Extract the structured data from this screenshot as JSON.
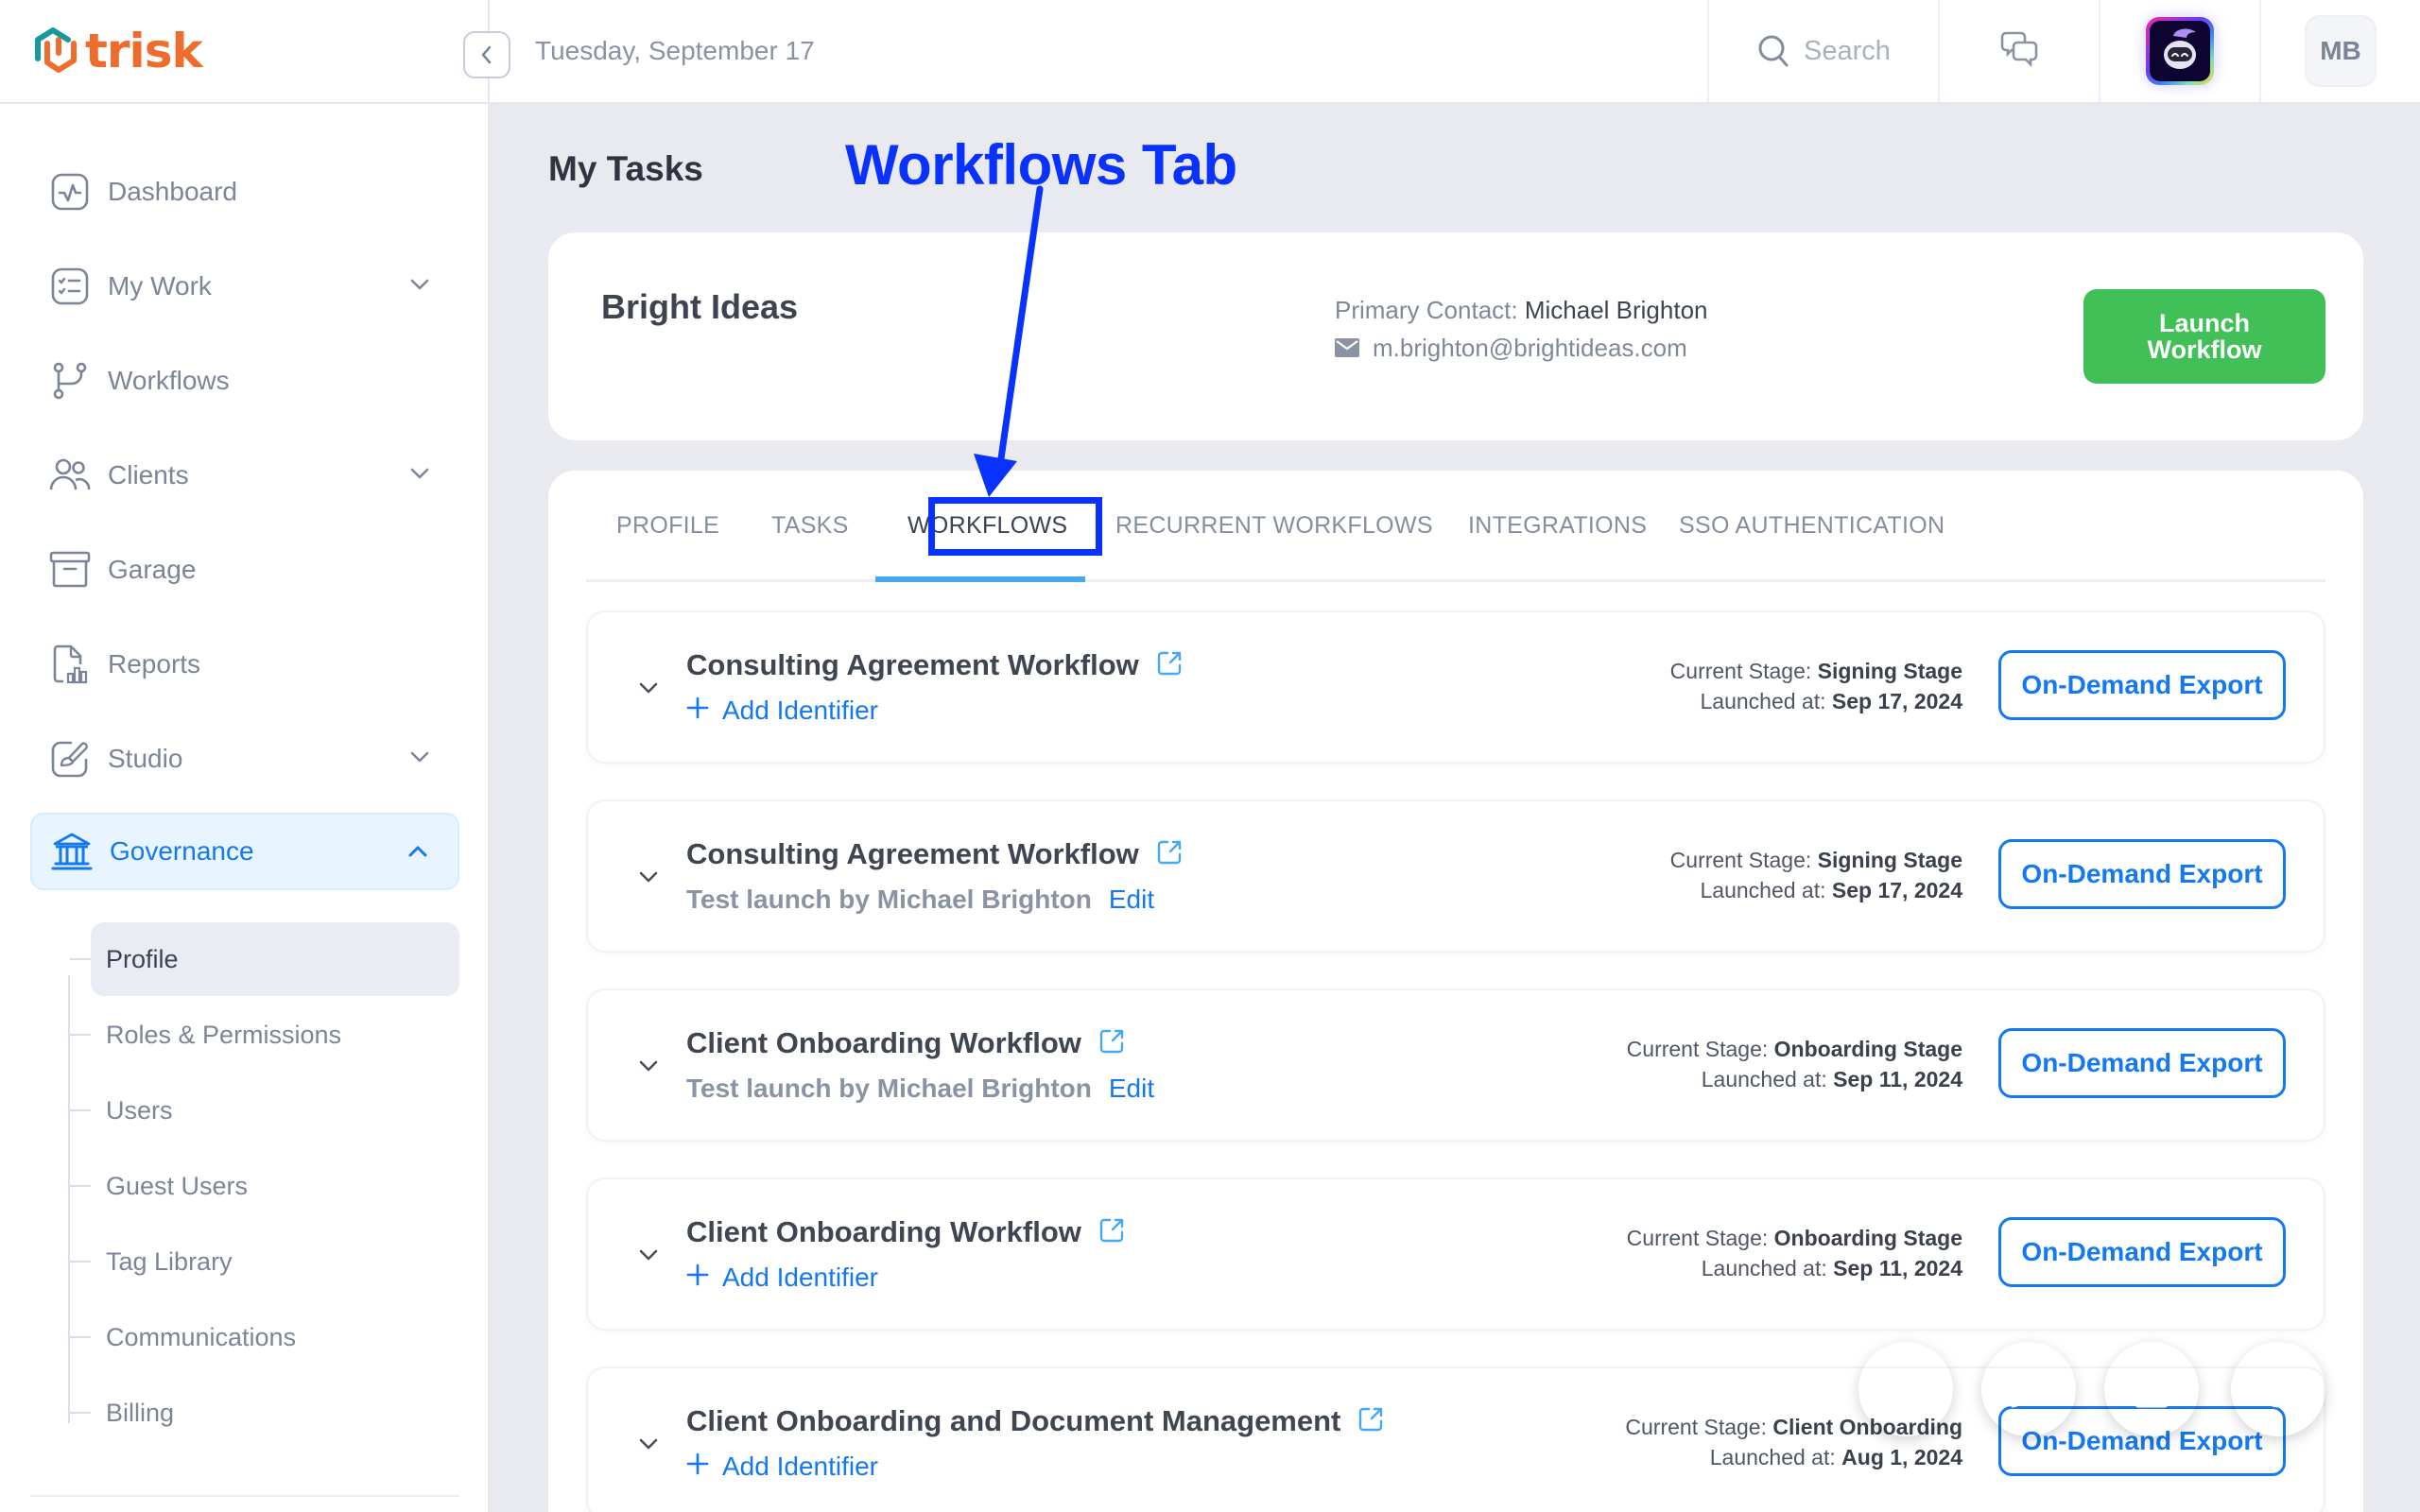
{
  "header": {
    "logo_text": "trisk",
    "date": "Tuesday, September 17",
    "search_label": "Search",
    "avatar_initials": "MB"
  },
  "sidebar": {
    "items": [
      {
        "label": "Dashboard",
        "icon": "dashboard-icon",
        "expandable": false
      },
      {
        "label": "My Work",
        "icon": "checklist-icon",
        "expandable": true
      },
      {
        "label": "Workflows",
        "icon": "workflow-branch-icon",
        "expandable": false
      },
      {
        "label": "Clients",
        "icon": "users-icon",
        "expandable": true
      },
      {
        "label": "Garage",
        "icon": "archive-icon",
        "expandable": false
      },
      {
        "label": "Reports",
        "icon": "report-icon",
        "expandable": false
      },
      {
        "label": "Studio",
        "icon": "brush-icon",
        "expandable": true
      },
      {
        "label": "Governance",
        "icon": "bank-icon",
        "expandable": true,
        "active": true,
        "expanded": true
      }
    ],
    "sub_items": [
      {
        "label": "Profile",
        "active": true
      },
      {
        "label": "Roles & Permissions"
      },
      {
        "label": "Users"
      },
      {
        "label": "Guest Users"
      },
      {
        "label": "Tag Library"
      },
      {
        "label": "Communications"
      },
      {
        "label": "Billing"
      }
    ]
  },
  "main": {
    "page_title": "My Tasks",
    "annotation": "Workflows Tab",
    "client": {
      "name": "Bright Ideas",
      "primary_contact_label": "Primary Contact:",
      "primary_contact_name": "Michael Brighton",
      "email": "m.brighton@brightideas.com",
      "launch_button": "Launch Workflow"
    },
    "tabs": [
      {
        "label": "PROFILE"
      },
      {
        "label": "TASKS"
      },
      {
        "label": "WORKFLOWS",
        "active": true
      },
      {
        "label": "RECURRENT WORKFLOWS"
      },
      {
        "label": "INTEGRATIONS"
      },
      {
        "label": "SSO AUTHENTICATION"
      }
    ],
    "stage_label": "Current Stage:",
    "launched_label": "Launched at:",
    "add_identifier_label": "Add Identifier",
    "edit_label": "Edit",
    "export_label": "On-Demand Export",
    "workflows": [
      {
        "title": "Consulting Agreement Workflow",
        "subtitle_type": "add",
        "stage": "Signing Stage",
        "launched": "Sep 17, 2024"
      },
      {
        "title": "Consulting Agreement Workflow",
        "subtitle_type": "test",
        "subtitle": "Test launch by Michael Brighton",
        "stage": "Signing Stage",
        "launched": "Sep 17, 2024"
      },
      {
        "title": "Client Onboarding Workflow",
        "subtitle_type": "test",
        "subtitle": "Test launch by Michael Brighton",
        "stage": "Onboarding Stage",
        "launched": "Sep 11, 2024"
      },
      {
        "title": "Client Onboarding Workflow",
        "subtitle_type": "add",
        "stage": "Onboarding Stage",
        "launched": "Sep 11, 2024"
      },
      {
        "title": "Client Onboarding and Document Management",
        "subtitle_type": "add",
        "stage": "Client Onboarding",
        "launched": "Aug 1, 2024"
      }
    ]
  },
  "fabs": [
    {
      "name": "quick-action",
      "icon": "lightning-icon",
      "color": "#0a72f5"
    },
    {
      "name": "launch",
      "icon": "rocket-icon",
      "color": "#5f12ea"
    },
    {
      "name": "archive",
      "icon": "archive-box-icon",
      "color": "#f8a74c"
    },
    {
      "name": "help",
      "icon": "help-icon",
      "color": "#40c057"
    }
  ],
  "colors": {
    "brand_orange": "#ee6c2c",
    "brand_teal": "#17999a",
    "accent_blue": "#1479f0",
    "launch_green": "#40c057",
    "annotation_blue": "#0a32ff"
  }
}
